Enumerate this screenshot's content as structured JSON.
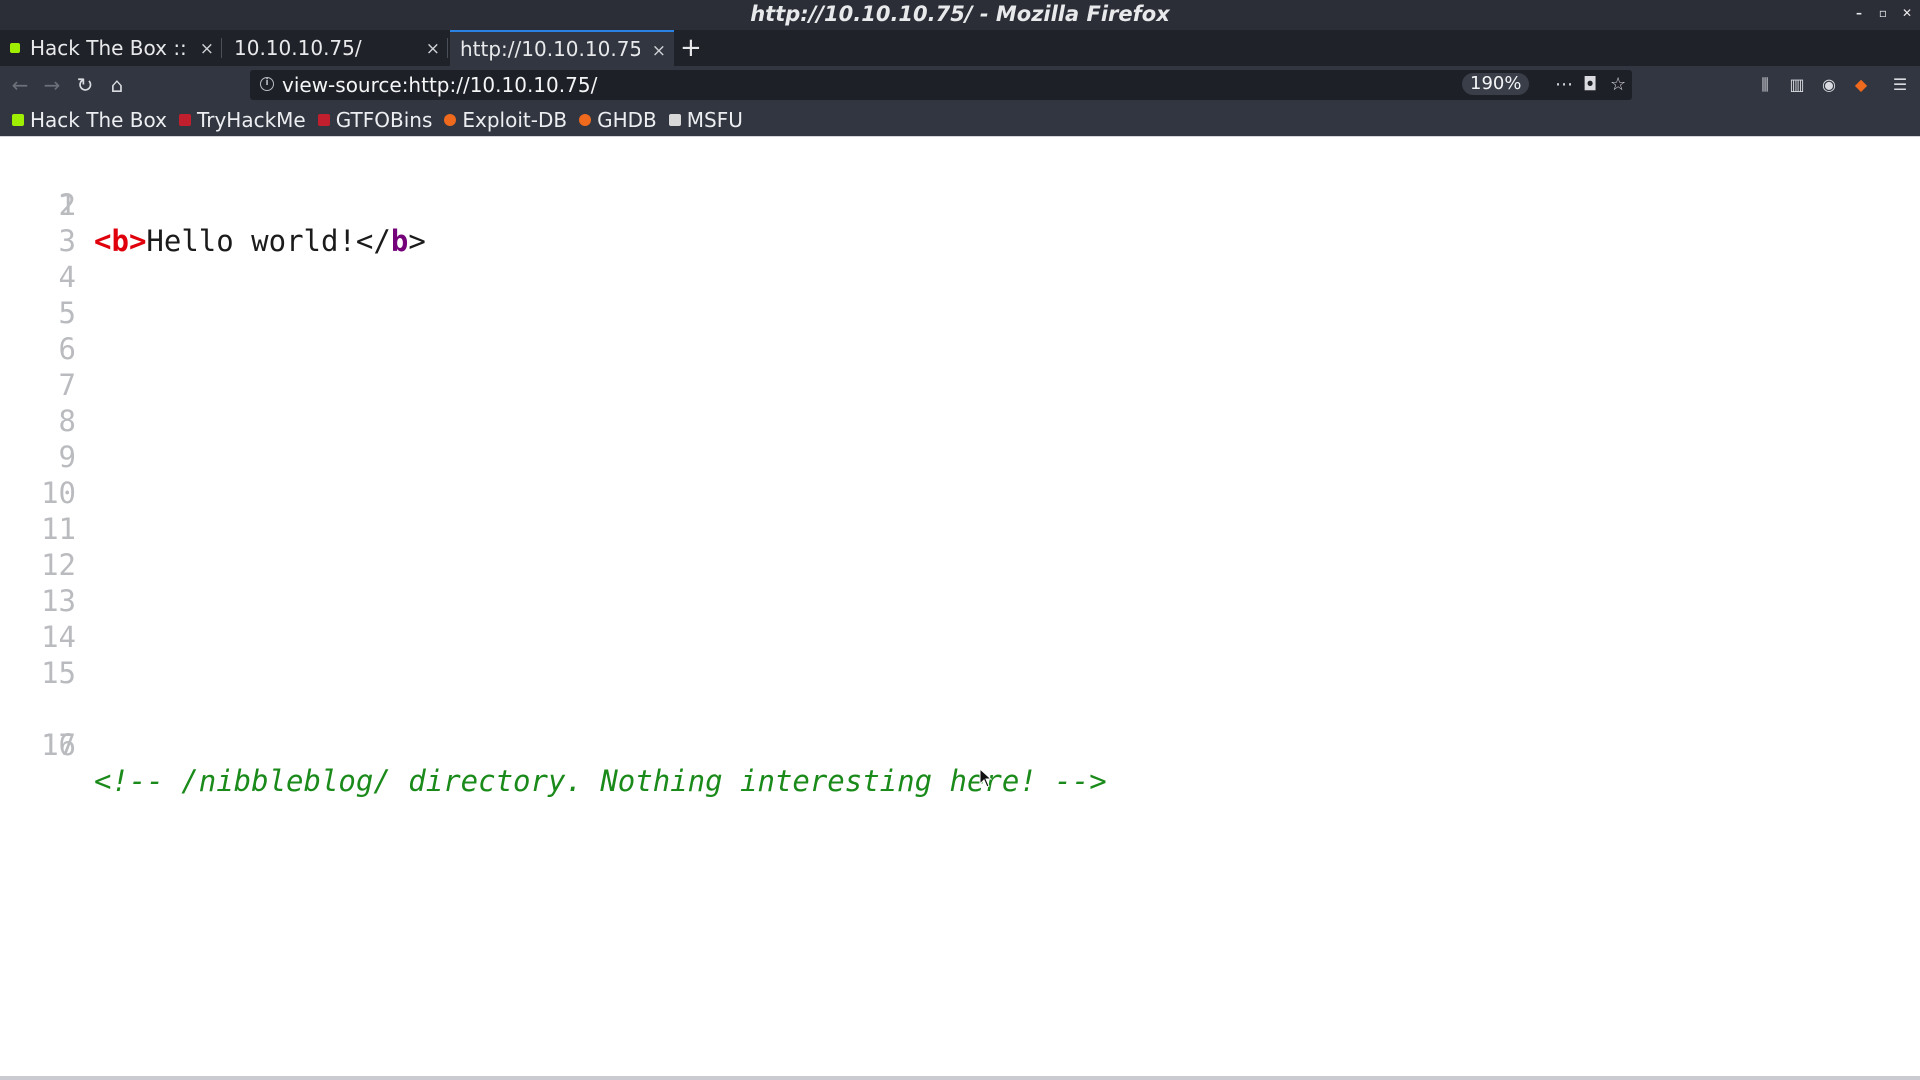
{
  "window": {
    "title": "http://10.10.10.75/ - Mozilla Firefox",
    "controls": [
      "minimize-icon",
      "maximize-icon",
      "close-icon"
    ]
  },
  "tabs": [
    {
      "label": "Hack The Box :: M",
      "close": "×",
      "active": false
    },
    {
      "label": "10.10.10.75/",
      "close": "×",
      "active": false
    },
    {
      "label": "http://10.10.10.75/",
      "close": "×",
      "active": true
    }
  ],
  "new_tab": "+",
  "navbar": {
    "url": "view-source:http://10.10.10.75/",
    "zoom": "190%",
    "icons": [
      "back-icon",
      "forward-icon",
      "reload-icon",
      "home-icon",
      "page-actions-icon",
      "pocket-icon",
      "bookmark-star-icon",
      "library-icon",
      "sidebar-icon",
      "account-icon",
      "extension-icon",
      "menu-icon"
    ]
  },
  "bookmarks": [
    {
      "label": "Hack The Box",
      "color": "#9fef00"
    },
    {
      "label": "TryHackMe",
      "color": "#c11f2d"
    },
    {
      "label": "GTFOBins",
      "color": "#c11f2d"
    },
    {
      "label": "Exploit-DB",
      "color": "#f06a1d"
    },
    {
      "label": "GHDB",
      "color": "#f06a1d"
    },
    {
      "label": "MSFU",
      "color": "#d8d8d8"
    }
  ],
  "source": {
    "line_numbers": [
      "1",
      "2",
      "3",
      "4",
      "5",
      "6",
      "7",
      "8",
      "9",
      "10",
      "11",
      "12",
      "13",
      "14",
      "15",
      "16",
      "17"
    ],
    "line1": {
      "open_lt": "<",
      "open_tag": "b",
      "open_gt": ">",
      "text": "Hello world!",
      "close_lt": "</",
      "close_tag": "b",
      "close_gt": ">"
    },
    "line16_comment": "<!-- /nibbleblog/ directory. Nothing interesting here! -->"
  },
  "colors": {
    "tag": "#e0000c",
    "end_tag_name": "#74007a",
    "comment": "#1a8a1a",
    "line_number": "#b9bbbf",
    "active_tab_accent": "#2a83e3"
  }
}
